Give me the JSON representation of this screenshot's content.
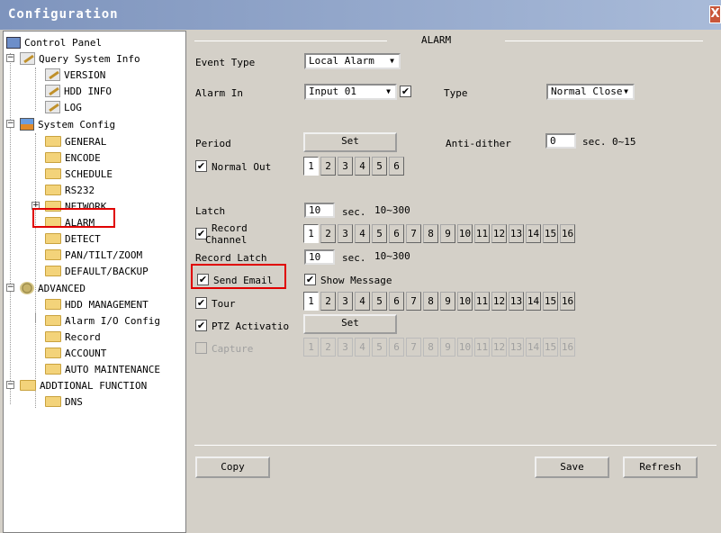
{
  "window": {
    "title": "Configuration",
    "close_glyph": "X"
  },
  "tree": {
    "control_panel": "Control Panel",
    "query_system_info": "Query System Info",
    "version": "VERSION",
    "hdd_info": "HDD INFO",
    "log": "LOG",
    "system_config": "System Config",
    "general": "GENERAL",
    "encode": "ENCODE",
    "schedule": "SCHEDULE",
    "rs232": "RS232",
    "network": "NETWORK",
    "alarm": "ALARM",
    "detect": "DETECT",
    "pan_tilt_zoom": "PAN/TILT/ZOOM",
    "default_backup": "DEFAULT/BACKUP",
    "advanced": "ADVANCED",
    "hdd_management": "HDD MANAGEMENT",
    "alarm_io_config": "Alarm I/O Config",
    "record": "Record",
    "account": "ACCOUNT",
    "auto_maintenance": "AUTO MAINTENANCE",
    "additional_function": "ADDTIONAL FUNCTION",
    "dns": "DNS"
  },
  "alarm": {
    "section_title": "ALARM",
    "event_type_label": "Event Type",
    "event_type_value": "Local Alarm",
    "alarm_in_label": "Alarm In",
    "alarm_in_value": "Input 01",
    "type_label": "Type",
    "type_value": "Normal Close",
    "period_label": "Period",
    "set_label": "Set",
    "anti_dither_label": "Anti-dither",
    "anti_dither_value": "0",
    "anti_dither_unit": "sec.",
    "anti_dither_range": "0~15",
    "normal_out_label": "Normal Out",
    "latch_label": "Latch",
    "latch_value": "10",
    "latch_unit": "sec.",
    "latch_range": "10~300",
    "record_channel_label_1": "Record",
    "record_channel_label_2": "Channel",
    "record_latch_label": "Record Latch",
    "record_latch_value": "10",
    "record_latch_unit": "sec.",
    "record_latch_range": "10~300",
    "send_email_label": "Send Email",
    "show_message_label": "Show Message",
    "tour_label": "Tour",
    "ptz_activation_label": "PTZ Activatio",
    "ptz_set_label": "Set",
    "capture_label": "Capture",
    "check_glyph": "✔",
    "arrow_glyph": "▼",
    "copy_label": "Copy",
    "save_label": "Save",
    "refresh_label": "Refresh",
    "outputs_6": [
      "1",
      "2",
      "3",
      "4",
      "5",
      "6"
    ],
    "channels_16": [
      "1",
      "2",
      "3",
      "4",
      "5",
      "6",
      "7",
      "8",
      "9",
      "10",
      "11",
      "12",
      "13",
      "14",
      "15",
      "16"
    ]
  },
  "colors": {
    "highlight": "#e00000",
    "titlebar": "#8fa5cc"
  }
}
